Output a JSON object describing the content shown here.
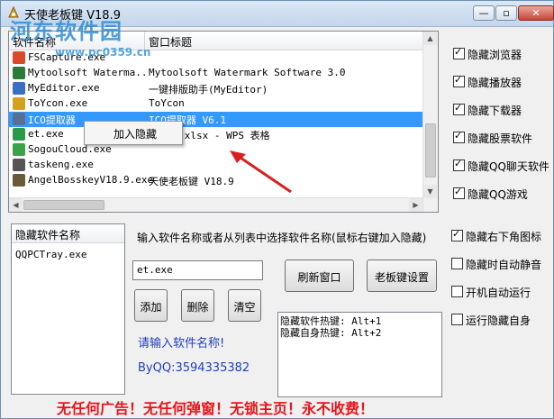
{
  "window": {
    "title": "天使老板键 V18.9",
    "watermark_text": "河东软件园",
    "watermark_url": "www.pc0359.cn"
  },
  "process_list": {
    "columns": [
      "软件名称",
      "窗口标题"
    ],
    "rows": [
      {
        "name": "FSCapture.exe",
        "title": "",
        "icon_color": "#d94a2a"
      },
      {
        "name": "Mytoolsoft Waterma..",
        "title": "Mytoolsoft Watermark Software 3.0",
        "icon_color": "#2c7a3a"
      },
      {
        "name": "MyEditor.exe",
        "title": "一键排版助手(MyEditor)",
        "icon_color": "#3a6fc2"
      },
      {
        "name": "ToYcon.exe",
        "title": "ToYcon",
        "icon_color": "#d4a020"
      },
      {
        "name": "ICO提取器",
        "title": "ICO提取器 V6.1",
        "icon_color": "#5a6f8f",
        "selected": true
      },
      {
        "name": "et.exe",
        "title": "09-18.xlsx - WPS 表格",
        "icon_color": "#2a9a4a"
      },
      {
        "name": "SogouCloud.exe",
        "title": "",
        "icon_color": "#3aa34a"
      },
      {
        "name": "taskeng.exe",
        "title": "",
        "icon_color": "#555555"
      },
      {
        "name": "AngelBosskeyV18.9.exe",
        "title": "天使老板键 V18.9",
        "icon_color": "#6a5a3a"
      }
    ]
  },
  "context_menu": {
    "item": "加入隐藏"
  },
  "right_checks": [
    {
      "label": "隐藏浏览器",
      "checked": true
    },
    {
      "label": "隐藏播放器",
      "checked": true
    },
    {
      "label": "隐藏下载器",
      "checked": true
    },
    {
      "label": "隐藏股票软件",
      "checked": true
    },
    {
      "label": "隐藏QQ聊天软件",
      "checked": true
    },
    {
      "label": "隐藏QQ游戏",
      "checked": true
    }
  ],
  "bottom_checks": [
    {
      "label": "隐藏右下角图标",
      "checked": true
    },
    {
      "label": "隐藏时自动静音",
      "checked": false
    },
    {
      "label": "开机自动运行",
      "checked": false
    },
    {
      "label": "运行隐藏自身",
      "checked": false
    }
  ],
  "hidden_list": {
    "header": "隐藏软件名称",
    "items": [
      "QQPCTray.exe"
    ]
  },
  "hint_text": "输入软件名称或者从列表中选择软件名称(鼠标右键加入隐藏)",
  "input_value": "et.exe",
  "buttons": {
    "refresh": "刷新窗口",
    "settings": "老板键设置",
    "add": "添加",
    "delete": "删除",
    "clear": "清空"
  },
  "prompt_text": "请输入软件名称!",
  "qq_text": "ByQQ:3594335382",
  "hotkeys": [
    "隐藏软件热键: Alt+1",
    "隐藏自身热键: Alt+2"
  ],
  "footer": "无任何广告！无任何弹窗！无锁主页！永不收费！"
}
